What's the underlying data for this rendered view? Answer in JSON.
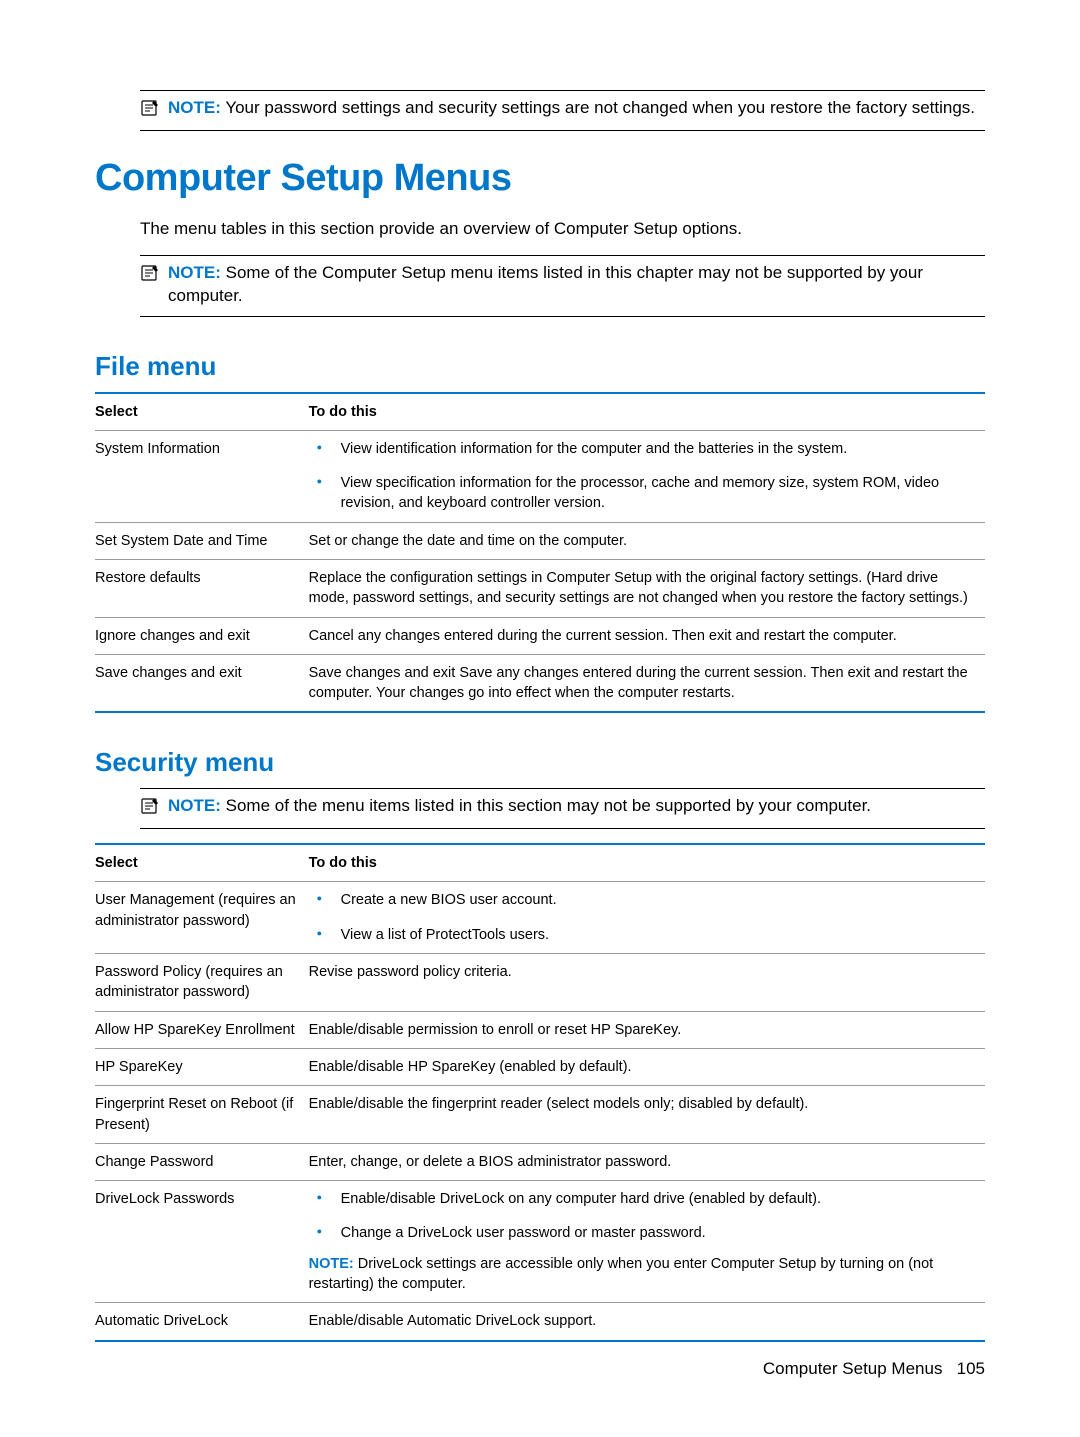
{
  "notes": {
    "top": {
      "label": "NOTE:",
      "text": "Your password settings and security settings are not changed when you restore the factory settings."
    },
    "after_h1": {
      "label": "NOTE:",
      "text": "Some of the Computer Setup menu items listed in this chapter may not be supported by your computer."
    },
    "security": {
      "label": "NOTE:",
      "text": "Some of the menu items listed in this section may not be supported by your computer."
    }
  },
  "h1": "Computer Setup Menus",
  "intro": "The menu tables in this section provide an overview of Computer Setup options.",
  "file_menu": {
    "heading": "File menu",
    "col1": "Select",
    "col2": "To do this",
    "rows": {
      "r0": {
        "select": "System Information",
        "bullets": {
          "b0": "View identification information for the computer and the batteries in the system.",
          "b1": "View specification information for the processor, cache and memory size, system ROM, video revision, and keyboard controller version."
        }
      },
      "r1": {
        "select": "Set System Date and Time",
        "desc": "Set or change the date and time on the computer."
      },
      "r2": {
        "select": "Restore defaults",
        "desc": "Replace the configuration settings in Computer Setup with the original factory settings. (Hard drive mode, password settings, and security settings are not changed when you restore the factory settings.)"
      },
      "r3": {
        "select": "Ignore changes and exit",
        "desc": "Cancel any changes entered during the current session. Then exit and restart the computer."
      },
      "r4": {
        "select": "Save changes and exit",
        "desc": "Save changes and exit Save any changes entered during the current session. Then exit and restart the computer. Your changes go into effect when the computer restarts."
      }
    }
  },
  "security_menu": {
    "heading": "Security menu",
    "col1": "Select",
    "col2": "To do this",
    "rows": {
      "r0": {
        "select": "User Management (requires an administrator password)",
        "bullets": {
          "b0": "Create a new BIOS user account.",
          "b1": "View a list of ProtectTools users."
        }
      },
      "r1": {
        "select": "Password Policy (requires an administrator password)",
        "desc": "Revise password policy criteria."
      },
      "r2": {
        "select": "Allow HP SpareKey Enrollment",
        "desc": "Enable/disable permission to enroll or reset HP SpareKey."
      },
      "r3": {
        "select": "HP SpareKey",
        "desc": "Enable/disable HP SpareKey (enabled by default)."
      },
      "r4": {
        "select": "Fingerprint Reset on Reboot (if Present)",
        "desc": "Enable/disable the fingerprint reader (select models only; disabled by default)."
      },
      "r5": {
        "select": "Change Password",
        "desc": "Enter, change, or delete a BIOS administrator password."
      },
      "r6": {
        "select": "DriveLock Passwords",
        "bullets": {
          "b0": "Enable/disable DriveLock on any computer hard drive (enabled by default).",
          "b1": "Change a DriveLock user password or master password."
        },
        "note_label": "NOTE:",
        "note_text": "DriveLock settings are accessible only when you enter Computer Setup by turning on (not restarting) the computer."
      },
      "r7": {
        "select": "Automatic DriveLock",
        "desc": "Enable/disable Automatic DriveLock support."
      }
    }
  },
  "footer": {
    "title": "Computer Setup Menus",
    "page": "105"
  }
}
